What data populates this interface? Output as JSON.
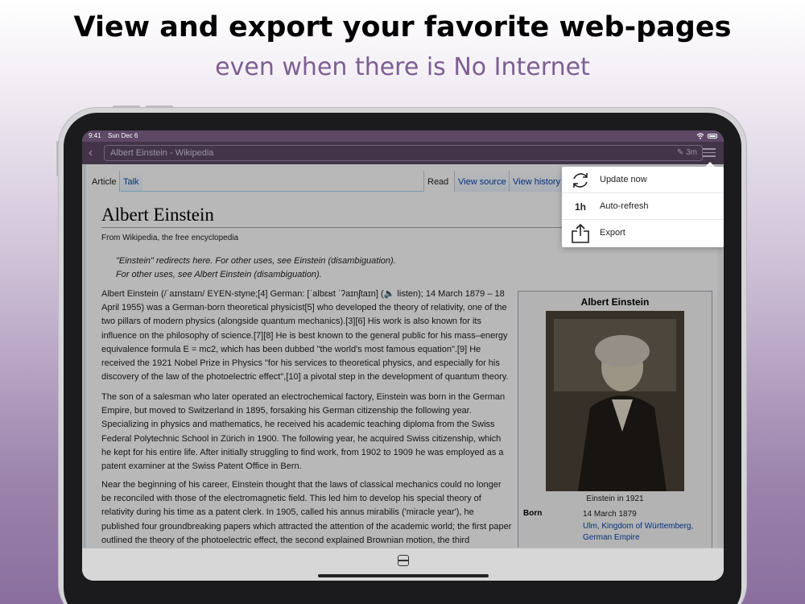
{
  "promo": {
    "headline": "View and export your favorite web-pages",
    "subline": "even when there is No Internet"
  },
  "status": {
    "time": "9:41",
    "date": "Sun Dec 6"
  },
  "nav": {
    "url_text": "Albert Einstein - Wikipedia",
    "age": "3m"
  },
  "tabs": {
    "article": "Article",
    "talk": "Talk",
    "read": "Read",
    "view_source": "View source",
    "view_history": "View history"
  },
  "article": {
    "title": "Albert Einstein",
    "from": "From Wikipedia, the free encyclopedia",
    "hatnote1": "\"Einstein\" redirects here. For other uses, see Einstein (disambiguation).",
    "hatnote2": "For other uses, see Albert Einstein (disambiguation).",
    "para1": "Albert Einstein (/ˈaɪnstaɪn/ EYEN-styne;[4] German: [ˈalbɛʁt ˈʔaɪnʃtaɪn] (🔈 listen); 14 March 1879 – 18 April 1955) was a German-born theoretical physicist[5] who developed the theory of relativity, one of the two pillars of modern physics (alongside quantum mechanics).[3][6] His work is also known for its influence on the philosophy of science.[7][8] He is best known to the general public for his mass–energy equivalence formula E = mc2, which has been dubbed \"the world's most famous equation\".[9] He received the 1921 Nobel Prize in Physics \"for his services to theoretical physics, and especially for his discovery of the law of the photoelectric effect\",[10] a pivotal step in the development of quantum theory.",
    "para2": "The son of a salesman who later operated an electrochemical factory, Einstein was born in the German Empire, but moved to Switzerland in 1895, forsaking his German citizenship the following year. Specializing in physics and mathematics, he received his academic teaching diploma from the Swiss Federal Polytechnic School in Zürich in 1900. The following year, he acquired Swiss citizenship, which he kept for his entire life. After initially struggling to find work, from 1902 to 1909 he was employed as a patent examiner at the Swiss Patent Office in Bern.",
    "para3": "Near the beginning of his career, Einstein thought that the laws of classical mechanics could no longer be reconciled with those of the electromagnetic field. This led him to develop his special theory of relativity during his time as a patent clerk. In 1905, called his annus mirabilis ('miracle year'), he published four groundbreaking papers which attracted the attention of the academic world; the first paper outlined the theory of the photoelectric effect, the second explained Brownian motion, the third"
  },
  "infobox": {
    "title": "Albert Einstein",
    "caption": "Einstein in 1921",
    "born_label": "Born",
    "born_line1": "14 March 1879",
    "born_line2": "Ulm, Kingdom of Württemberg,",
    "born_line3": "German Empire"
  },
  "menu": {
    "items": [
      {
        "label": "Update now",
        "icon": "refresh-icon"
      },
      {
        "label": "Auto-refresh",
        "icon": "1h"
      },
      {
        "label": "Export",
        "icon": "share-icon"
      }
    ]
  },
  "colors": {
    "accent": "#5d4866",
    "link": "#0645ad",
    "promo_sub": "#7d5f91"
  }
}
